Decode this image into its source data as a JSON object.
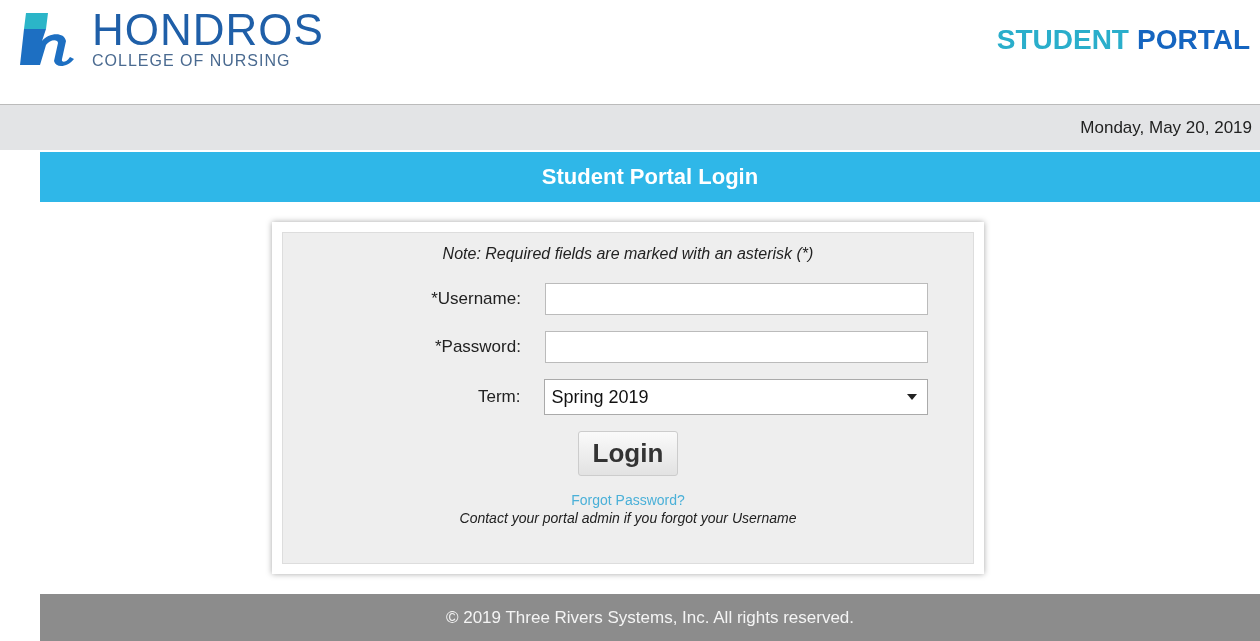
{
  "header": {
    "logo_name": "HONDROS",
    "logo_subtitle": "COLLEGE OF NURSING",
    "portal_logo": [
      "STUDENT",
      "PORTAL"
    ]
  },
  "date": "Monday, May 20, 2019",
  "banner": "Student Portal Login",
  "form": {
    "note": "Note: Required fields are marked with an asterisk (*)",
    "fields": [
      {
        "kind": "text",
        "label": "*Username:"
      },
      {
        "kind": "password",
        "label": "*Password:"
      },
      {
        "kind": "select",
        "label": "Term:",
        "value": "Spring 2019"
      }
    ],
    "submit": "Login",
    "forgot_link": "Forgot Password?",
    "help": "Contact your portal admin if you forgot your Username"
  },
  "footer": "© 2019 Three Rivers Systems, Inc. All rights reserved."
}
